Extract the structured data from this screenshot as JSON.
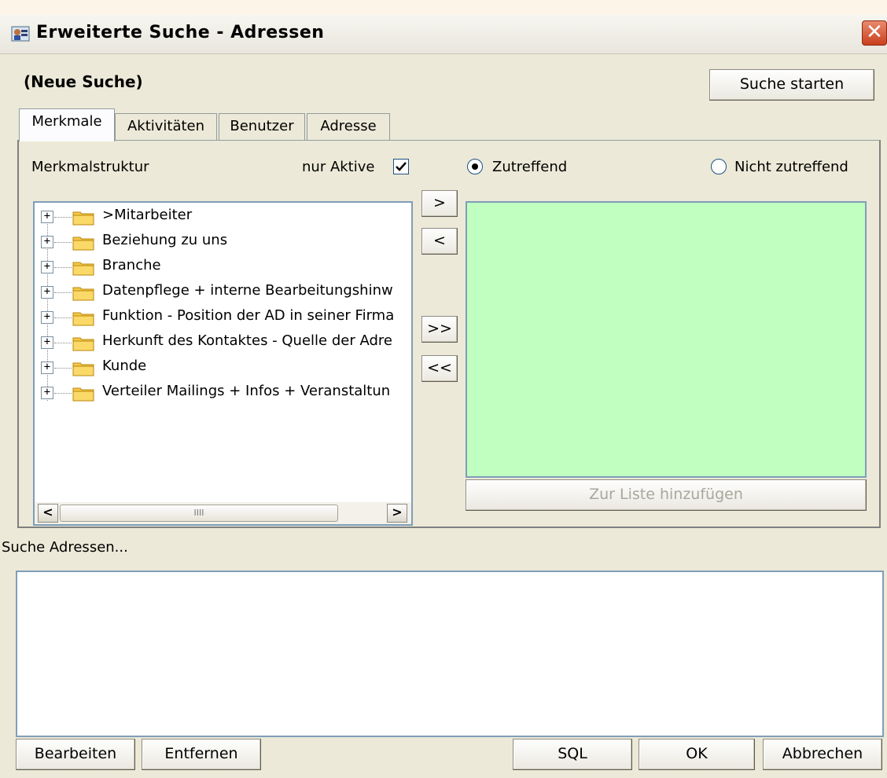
{
  "window": {
    "title": "Erweiterte Suche - Adressen",
    "close_label": "✕"
  },
  "header": {
    "search_name": "(Neue Suche)",
    "start_button": "Suche starten"
  },
  "tabs": [
    {
      "label": "Merkmale",
      "active": true
    },
    {
      "label": "Aktivitäten",
      "active": false
    },
    {
      "label": "Benutzer",
      "active": false
    },
    {
      "label": "Adresse",
      "active": false
    }
  ],
  "merkmale": {
    "structure_label": "Merkmalstruktur",
    "only_active_label": "nur Aktive",
    "only_active_checked": true,
    "tree_items": [
      ">Mitarbeiter",
      "Beziehung zu uns",
      "Branche",
      "Datenpflege + interne Bearbeitungshinw",
      "Funktion - Position der AD in seiner Firma",
      "Herkunft des Kontaktes - Quelle der Adre",
      "Kunde",
      "Verteiler Mailings + Infos + Veranstaltun"
    ],
    "transfer_buttons": {
      "add_one": ">",
      "remove_one": "<",
      "add_all": ">>",
      "remove_all": "<<"
    },
    "match_options": {
      "matching_label": "Zutreffend",
      "not_matching_label": "Nicht zutreffend",
      "selected": "matching"
    },
    "add_to_list_button": "Zur Liste hinzufügen",
    "scrollbar_thumb": "IIII"
  },
  "results": {
    "label": "Suche Adressen..."
  },
  "footer": {
    "edit_button": "Bearbeiten",
    "remove_button": "Entfernen",
    "sql_button": "SQL",
    "ok_button": "OK",
    "cancel_button": "Abbrechen"
  }
}
